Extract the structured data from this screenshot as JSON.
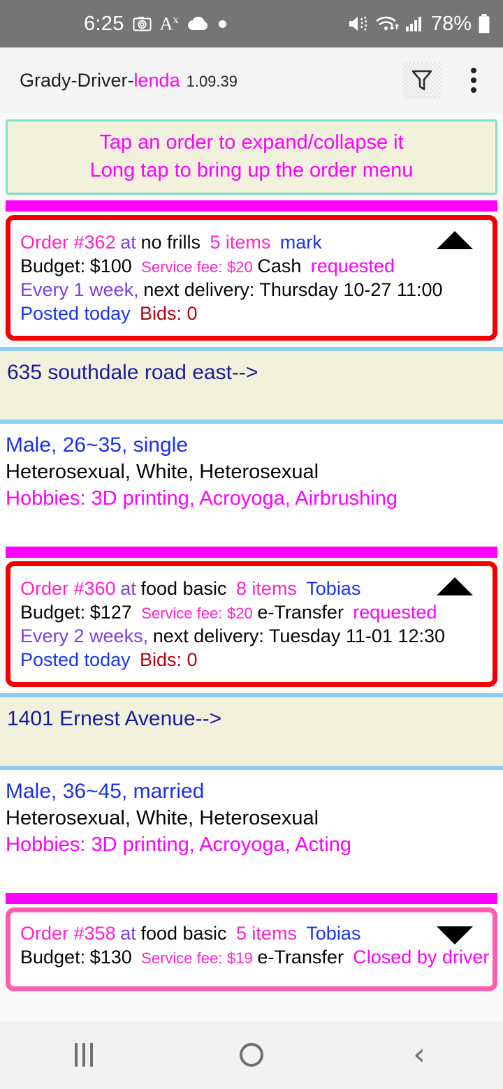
{
  "status_bar": {
    "time": "6:25",
    "icons_left": [
      "camera-icon",
      "text-size-icon",
      "cloud-icon",
      "dot-icon"
    ],
    "text_icon_label": "A",
    "text_icon_sup": "x",
    "icons_right": [
      "mute-icon",
      "wifi-icon",
      "cellular-signal-icon"
    ],
    "battery_percent": "78%"
  },
  "app_bar": {
    "title_prefix": "Grady-Driver-",
    "title_brand": "lenda",
    "version": "1.09.39",
    "filter_icon": "filter-funnel-icon",
    "overflow_icon": "more-vertical-icon"
  },
  "hint": {
    "line1": "Tap an order to expand/collapse it",
    "line2": "Long tap to bring up the order menu"
  },
  "orders": [
    {
      "order_label": "Order #362",
      "at": "at",
      "store": "no frills",
      "items": "5 items",
      "customer": "mark",
      "budget_label": "Budget:",
      "budget": "$100",
      "service_fee_label": "Service fee:",
      "service_fee": "$20",
      "payment": "Cash",
      "status": "requested",
      "frequency": "Every 1 week,",
      "next_delivery": "next delivery: Thursday 10-27 11:00",
      "posted": "Posted today",
      "bids": "Bids: 0",
      "expanded": true,
      "caret": "caret-up-icon",
      "border_color": "#f40000",
      "address": "635 southdale road east-->",
      "demo_line1": "Male, 26~35, single",
      "demo_line2": "Heterosexual, White, Heterosexual",
      "demo_line3": "Hobbies: 3D printing, Acroyoga, Airbrushing"
    },
    {
      "order_label": "Order #360",
      "at": "at",
      "store": "food basic",
      "items": "8 items",
      "customer": "Tobias",
      "budget_label": "Budget:",
      "budget": "$127",
      "service_fee_label": "Service fee:",
      "service_fee": "$20",
      "payment": "e-Transfer",
      "status": "requested",
      "frequency": "Every 2 weeks,",
      "next_delivery": "next delivery: Tuesday 11-01 12:30",
      "posted": "Posted today",
      "bids": "Bids: 0",
      "expanded": true,
      "caret": "caret-up-icon",
      "border_color": "#f40000",
      "address": "1401 Ernest Avenue-->",
      "demo_line1": "Male, 36~45, married",
      "demo_line2": "Heterosexual, White, Heterosexual",
      "demo_line3": "Hobbies: 3D printing, Acroyoga, Acting"
    },
    {
      "order_label": "Order #358",
      "at": "at",
      "store": "food basic",
      "items": "5 items",
      "customer": "Tobias",
      "budget_label": "Budget:",
      "budget": "$130",
      "service_fee_label": "Service fee:",
      "service_fee": "$19",
      "payment": "e-Transfer",
      "status": "Closed by driver",
      "expanded": false,
      "caret": "caret-down-icon",
      "border_color": "#f95fae"
    }
  ],
  "nav_bar": {
    "recents": "recents-icon",
    "home": "home-icon",
    "back": "back-icon"
  },
  "colors": {
    "magenta": "#ff00ff",
    "red_border": "#f40000",
    "pink_border": "#f95fae",
    "mint_border": "#7fe3c0",
    "cream_bg": "#f2f2dc",
    "sky_border": "#8ccdf0",
    "navy_text": "#1a1a9c",
    "blue_text": "#1a2ff0",
    "purple_text": "#7b3fe4",
    "dark_red_text": "#b50012"
  }
}
